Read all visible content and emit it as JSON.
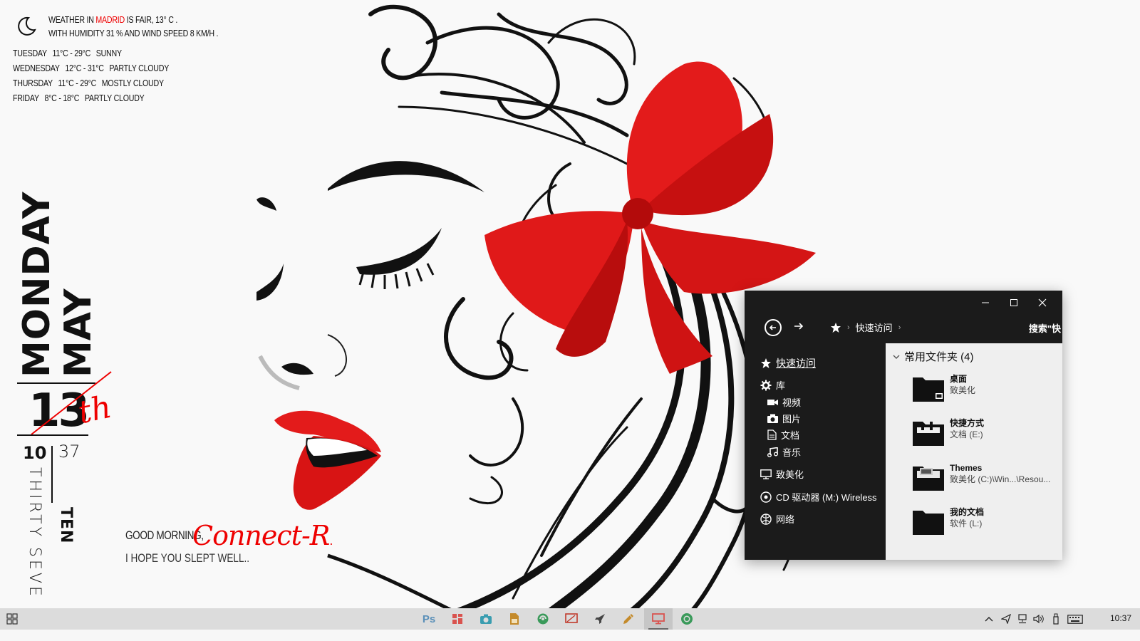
{
  "weather": {
    "line1_prefix": "Weather in",
    "city": "Madrid",
    "line1_suffix": "is fair, 13° C .",
    "line2": "with humidity 31 % and wind speed 8 km/h .",
    "forecast": [
      {
        "day": "Tuesday",
        "range": "11°C - 29°C",
        "cond": "Sunny"
      },
      {
        "day": "Wednesday",
        "range": "12°C - 31°C",
        "cond": "Partly Cloudy"
      },
      {
        "day": "Thursday",
        "range": "11°C - 29°C",
        "cond": "Mostly Cloudy"
      },
      {
        "day": "Friday",
        "range": "8°C - 18°C",
        "cond": "Partly Cloudy"
      }
    ],
    "icon": "moon-icon"
  },
  "clock_widget": {
    "weekday": "MONDAY",
    "month": "MAY",
    "day": "13",
    "suffix": "th",
    "hour": "10",
    "minute": "37",
    "hour_word": "TEN",
    "minute_word": "THIRTY SEVE"
  },
  "greeting": {
    "line1": "Good morning,",
    "name": "Connect-R",
    "name_dot": ".",
    "line2": "I hope you slept well.."
  },
  "explorer": {
    "window_buttons": [
      "minimize-icon",
      "maximize-icon",
      "close-icon"
    ],
    "breadcrumb": [
      "快速访问"
    ],
    "search_label": "搜索\"快",
    "nav": {
      "quick_access": "快速访问",
      "library": "库",
      "videos": "视频",
      "pictures": "图片",
      "documents": "文档",
      "music": "音乐",
      "this_pc": "致美化",
      "cd_drive": "CD 驱动器 (M:) Wireless",
      "network": "网络"
    },
    "group_header": "常用文件夹 (4)",
    "folders": [
      {
        "title": "桌面",
        "sub": "致美化"
      },
      {
        "title": "快捷方式",
        "sub": "文档 (E:)"
      },
      {
        "title": "Themes",
        "sub": "致美化 (C:)\\Win...\\Resou..."
      },
      {
        "title": "我的文档",
        "sub": "软件 (L:)"
      }
    ]
  },
  "taskbar": {
    "start_icon": "start-icon",
    "apps": [
      {
        "name": "photoshop",
        "label": "Ps",
        "color": "#5a8fb8"
      },
      {
        "name": "tiles-app",
        "color": "#d9534f"
      },
      {
        "name": "camera-app",
        "color": "#3a9db0"
      },
      {
        "name": "file-manager",
        "color": "#c48a2a"
      },
      {
        "name": "recycle-app",
        "color": "#3a9a5a"
      },
      {
        "name": "screen-app",
        "color": "#c0392b"
      },
      {
        "name": "rocket-app",
        "color": "#444444"
      },
      {
        "name": "pen-app",
        "color": "#c48a2a"
      },
      {
        "name": "desktop-app",
        "color": "#d9534f"
      },
      {
        "name": "chrome-app",
        "color": "#3a9a5a"
      }
    ],
    "tray_icons": [
      "chevron-up-icon",
      "send-icon",
      "network-icon",
      "volume-icon",
      "usb-icon",
      "keyboard-icon"
    ],
    "time": "10:37"
  }
}
